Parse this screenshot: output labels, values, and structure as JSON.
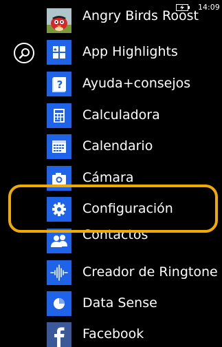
{
  "status_bar": {
    "time": "14:09",
    "icons": [
      "battery-charging-icon"
    ]
  },
  "search": {
    "icon": "search-icon"
  },
  "apps": [
    {
      "label": "Angry Birds Roost",
      "icon": "angry-birds-icon",
      "tile_color": "#b0c4cc"
    },
    {
      "label": "App Highlights",
      "icon": "app-highlights-icon",
      "tile_color": "#1e63e8"
    },
    {
      "label": "Ayuda+consejos",
      "icon": "help-icon",
      "tile_color": "#1e63e8"
    },
    {
      "label": "Calculadora",
      "icon": "calculator-icon",
      "tile_color": "#1e63e8"
    },
    {
      "label": "Calendario",
      "icon": "calendar-icon",
      "tile_color": "#1e63e8"
    },
    {
      "label": "Cámara",
      "icon": "camera-icon",
      "tile_color": "#1e63e8"
    },
    {
      "label": "Configuración",
      "icon": "gear-icon",
      "tile_color": "#1e63e8"
    },
    {
      "label": "Contactos",
      "icon": "people-icon",
      "tile_color": "#1e63e8"
    },
    {
      "label": "Creador de Ringtone",
      "icon": "ringtone-icon",
      "tile_color": "#1e63e8"
    },
    {
      "label": "Data Sense",
      "icon": "data-sense-icon",
      "tile_color": "#1e63e8"
    },
    {
      "label": "Facebook",
      "icon": "facebook-icon",
      "tile_color": "#3b5998"
    }
  ],
  "highlight": {
    "target": "Configuración",
    "color": "#f0ab00"
  },
  "colors": {
    "accent": "#1e63e8",
    "background": "#000000",
    "highlight": "#f0ab00"
  }
}
